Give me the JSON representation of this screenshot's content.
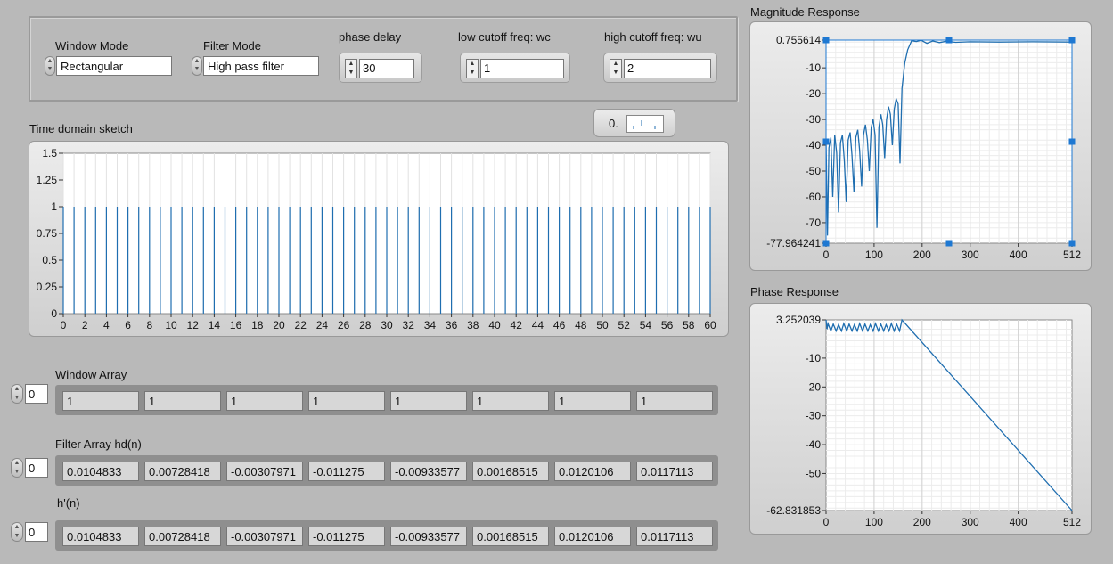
{
  "controls": {
    "window_mode_label": "Window Mode",
    "window_mode_value": "Rectangular",
    "filter_mode_label": "Filter Mode",
    "filter_mode_value": "High pass filter",
    "phase_delay_label": "phase delay",
    "phase_delay_value": "30",
    "low_cutoff_label": "low cutoff freq: wc",
    "low_cutoff_value": "1",
    "high_cutoff_label": "high cutoff freq: wu",
    "high_cutoff_value": "2"
  },
  "time_domain": {
    "title": "Time domain sketch",
    "slider_readout": "0.",
    "y_ticks": [
      "1.5",
      "1.25",
      "1",
      "0.75",
      "0.5",
      "0.25",
      "0"
    ],
    "x_ticks": [
      "0",
      "2",
      "4",
      "6",
      "8",
      "10",
      "12",
      "14",
      "16",
      "18",
      "20",
      "22",
      "24",
      "26",
      "28",
      "30",
      "32",
      "34",
      "36",
      "38",
      "40",
      "42",
      "44",
      "46",
      "48",
      "50",
      "52",
      "54",
      "56",
      "58",
      "60"
    ]
  },
  "magnitude": {
    "title": "Magnitude Response",
    "y_ticks": [
      "0.755614",
      "-10",
      "-20",
      "-30",
      "-40",
      "-50",
      "-60",
      "-70",
      "-77.964241"
    ],
    "x_ticks": [
      "0",
      "100",
      "200",
      "300",
      "400",
      "512"
    ]
  },
  "phase": {
    "title": "Phase Response",
    "y_ticks": [
      "3.252039",
      "-10",
      "-20",
      "-30",
      "-40",
      "-50",
      "-62.831853"
    ],
    "x_ticks": [
      "0",
      "100",
      "200",
      "300",
      "400",
      "512"
    ]
  },
  "arrays": {
    "window": {
      "label": "Window  Array",
      "index": "0",
      "values": [
        "1",
        "1",
        "1",
        "1",
        "1",
        "1",
        "1",
        "1"
      ]
    },
    "filter": {
      "label": "Filter Array hd(n)",
      "index": "0",
      "values": [
        "0.0104833",
        "0.00728418",
        "-0.00307971",
        "-0.011275",
        "-0.00933577",
        "0.00168515",
        "0.0120106",
        "0.0117113"
      ]
    },
    "hprime": {
      "label": "h'(n)",
      "index": "0",
      "values": [
        "0.0104833",
        "0.00728418",
        "-0.00307971",
        "-0.011275",
        "-0.00933577",
        "0.00168515",
        "0.0120106",
        "0.0117113"
      ]
    }
  },
  "colors": {
    "trace": "#1f6eb0",
    "cursor": "#1e78d2",
    "panel_bg": "#b9b9b9"
  }
}
